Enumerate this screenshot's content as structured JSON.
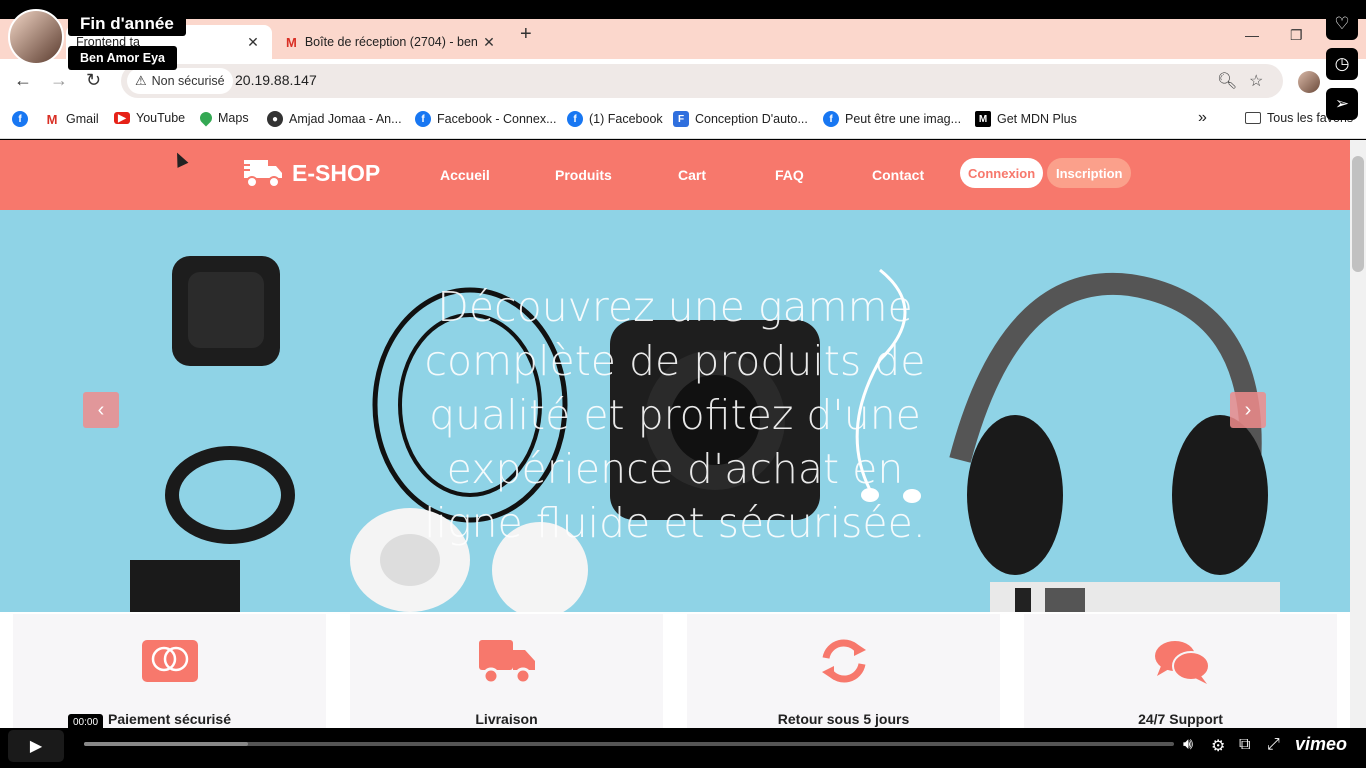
{
  "video": {
    "title": "Fin d'année",
    "author": "Ben Amor Eya",
    "time": "00:00",
    "progress": 0.15,
    "brand": "vimeo"
  },
  "browser": {
    "tabs": [
      {
        "label": "Frontend ta",
        "icon": "site-icon",
        "active": true
      },
      {
        "label": "Boîte de réception (2704) - ben",
        "icon": "gmail-icon",
        "active": false
      }
    ],
    "new_tab": "+",
    "address": {
      "security": "Non sécurisé",
      "url": "20.19.88.147"
    },
    "bookmarks": [
      {
        "label": "",
        "icon": "facebook-icon"
      },
      {
        "label": "Gmail",
        "icon": "gmail-icon"
      },
      {
        "label": "YouTube",
        "icon": "youtube-icon"
      },
      {
        "label": "Maps",
        "icon": "maps-icon"
      },
      {
        "label": "Amjad Jomaa - An...",
        "icon": "globe-icon"
      },
      {
        "label": "Facebook - Connex...",
        "icon": "facebook-icon"
      },
      {
        "label": "(1) Facebook",
        "icon": "facebook-icon"
      },
      {
        "label": "Conception D'auto...",
        "icon": "forms-icon"
      },
      {
        "label": "Peut être une imag...",
        "icon": "facebook-icon"
      },
      {
        "label": "Get MDN Plus",
        "icon": "mdn-icon"
      }
    ],
    "all_bookmarks": "Tous les favoris",
    "overflow": "»"
  },
  "site": {
    "brand": "E-SHOP",
    "nav": [
      "Accueil",
      "Produits",
      "Cart",
      "FAQ",
      "Contact"
    ],
    "login": "Connexion",
    "signup": "Inscription",
    "hero_text": "Découvrez une gamme complète de produits de qualité et profitez d'une expérience d'achat en ligne fluide et sécurisée.",
    "features": [
      {
        "title": "Paiement sécurisé",
        "icon": "credit-card-icon"
      },
      {
        "title": "Livraison",
        "icon": "truck-icon"
      },
      {
        "title": "Retour sous 5 jours",
        "icon": "refresh-icon"
      },
      {
        "title": "24/7 Support",
        "icon": "chat-icon"
      }
    ],
    "colors": {
      "primary": "#f7786c",
      "hero_bg": "#8fd3e6"
    }
  }
}
